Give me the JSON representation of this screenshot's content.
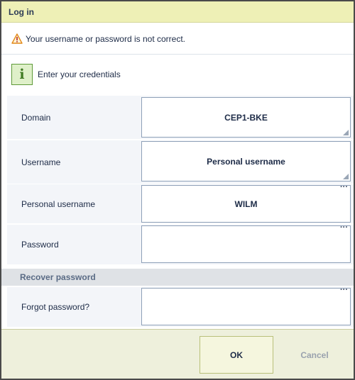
{
  "dialog": {
    "title": "Log in",
    "error_message": "Your username or password is not correct.",
    "info_message": "Enter your credentials"
  },
  "form": {
    "domain": {
      "label": "Domain",
      "value": "CEP1-BKE"
    },
    "username": {
      "label": "Username",
      "value": "Personal username"
    },
    "personal_username": {
      "label": "Personal username",
      "value": "WILM",
      "more": "···"
    },
    "password": {
      "label": "Password",
      "value": "",
      "more": "···"
    },
    "recover_section": {
      "title": "Recover password"
    },
    "forgot_password": {
      "label": "Forgot password?",
      "value": "",
      "more": "···"
    }
  },
  "footer": {
    "ok_label": "OK",
    "cancel_label": "Cancel"
  },
  "icons": {
    "warning": "warning-triangle-icon",
    "info": "info-icon"
  },
  "colors": {
    "titlebar_bg": "#eef0b6",
    "footer_bg": "#eef0dc",
    "row_bg": "#f3f5f9",
    "section_bg": "#dfe2e6",
    "warning_orange": "#e28a1a",
    "info_green": "#5e9a38"
  }
}
